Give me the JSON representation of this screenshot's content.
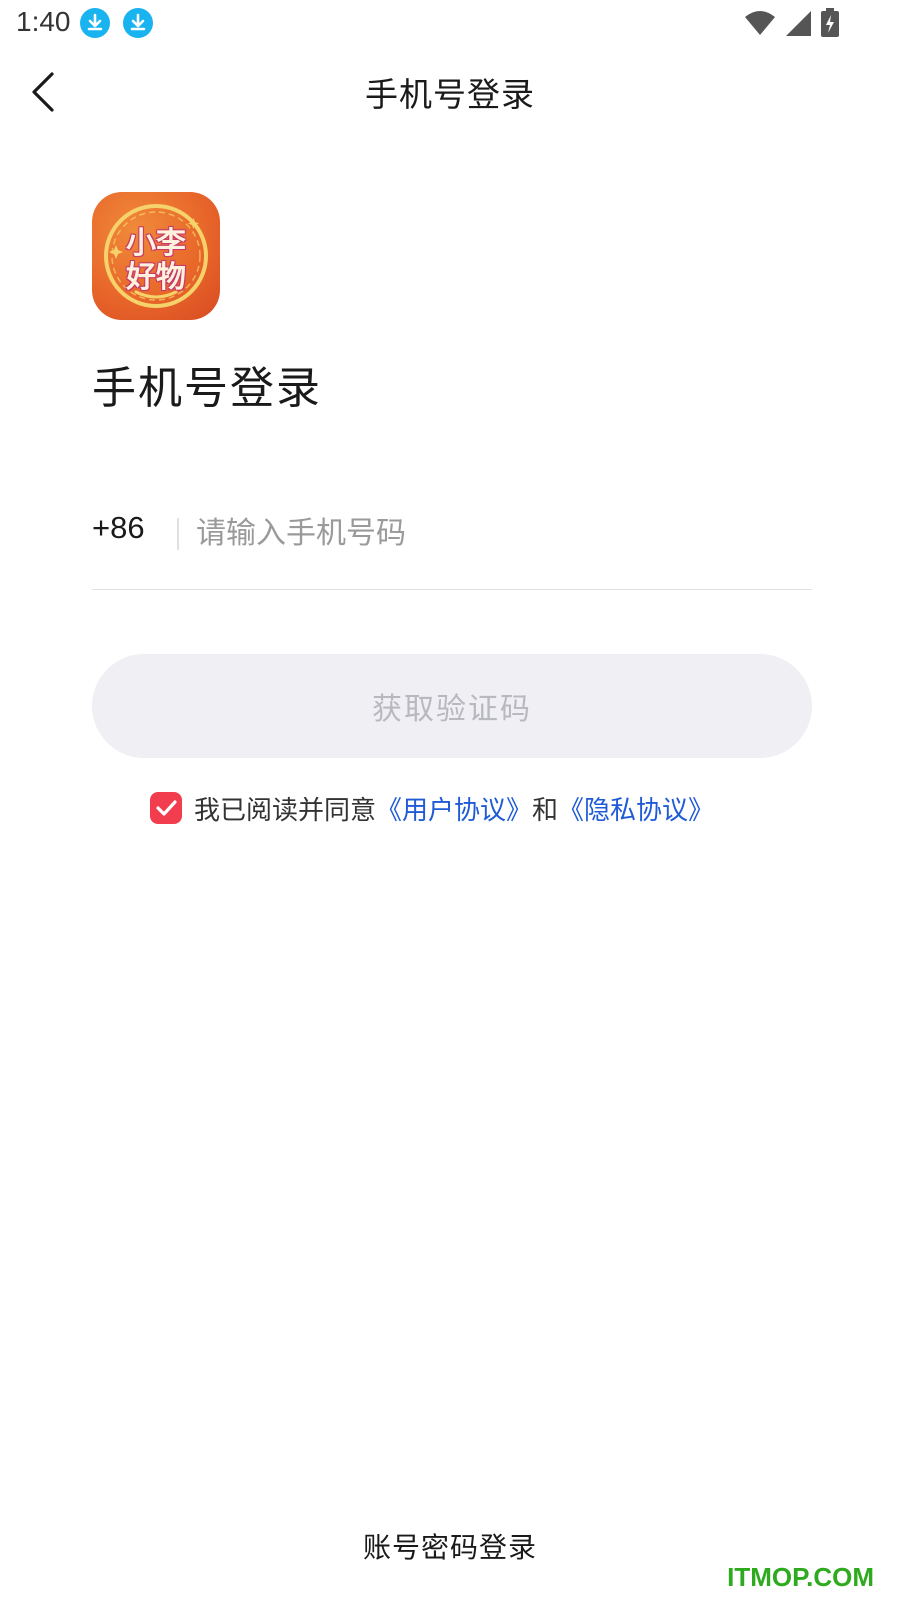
{
  "status_bar": {
    "time": "1:40",
    "icons": [
      "download-icon",
      "download-icon",
      "wifi-icon",
      "signal-icon",
      "battery-charging-icon"
    ]
  },
  "header": {
    "back_icon": "chevron-left-icon",
    "title": "手机号登录"
  },
  "logo": {
    "line1": "小李",
    "line2": "好物",
    "colors": {
      "background": "#e8672a",
      "text": "#fff2dc",
      "outline": "#c73a6a"
    }
  },
  "page_heading": "手机号登录",
  "phone_field": {
    "country_code": "+86",
    "value": "",
    "placeholder": "请输入手机号码"
  },
  "get_code_button": {
    "label": "获取验证码"
  },
  "agreement": {
    "checked": true,
    "prefix": "我已阅读并同意",
    "user_agreement": "《用户协议》",
    "conjunction": "和",
    "privacy_policy": "《隐私协议》"
  },
  "password_login_label": "账号密码登录",
  "watermark": "ITMOP.COM",
  "colors": {
    "accent_red": "#f23d4f",
    "link_blue": "#1f5bd6",
    "button_disabled_bg": "#efeff4",
    "button_disabled_text": "#b8b8bf",
    "download_blue": "#19b3f0",
    "watermark_green": "#2eaa1e"
  }
}
